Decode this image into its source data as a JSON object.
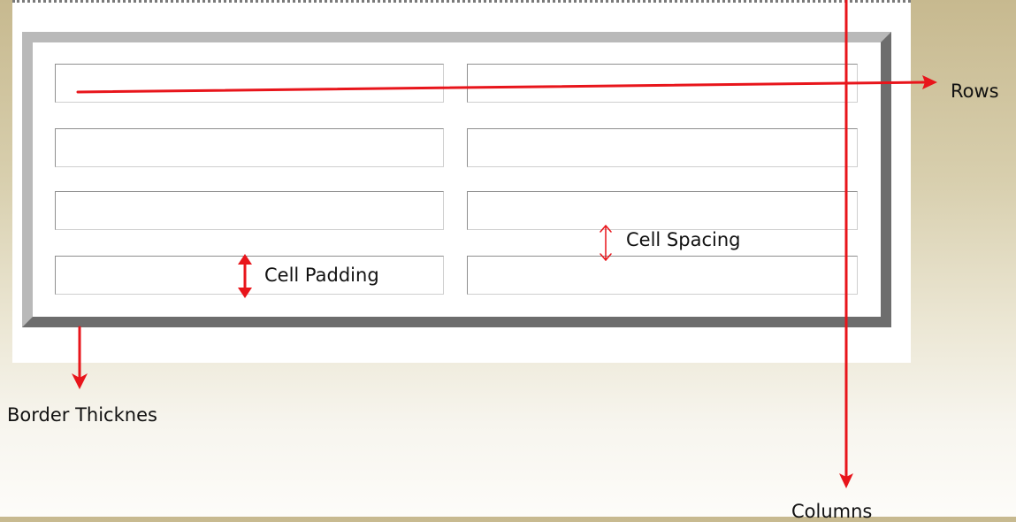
{
  "labels": {
    "rows": "Rows",
    "columns": "Columns",
    "cell_spacing": "Cell Spacing",
    "cell_padding": "Cell Padding",
    "border_thickness": "Border Thicknes"
  },
  "table": {
    "rows": 4,
    "columns": 2
  },
  "colors": {
    "arrow": "#e8151b",
    "frame_light": "#b9b9b9",
    "frame_dark": "#6d6d6d",
    "background_top": "#c7b98f",
    "background_bottom": "#fdfcf9"
  }
}
